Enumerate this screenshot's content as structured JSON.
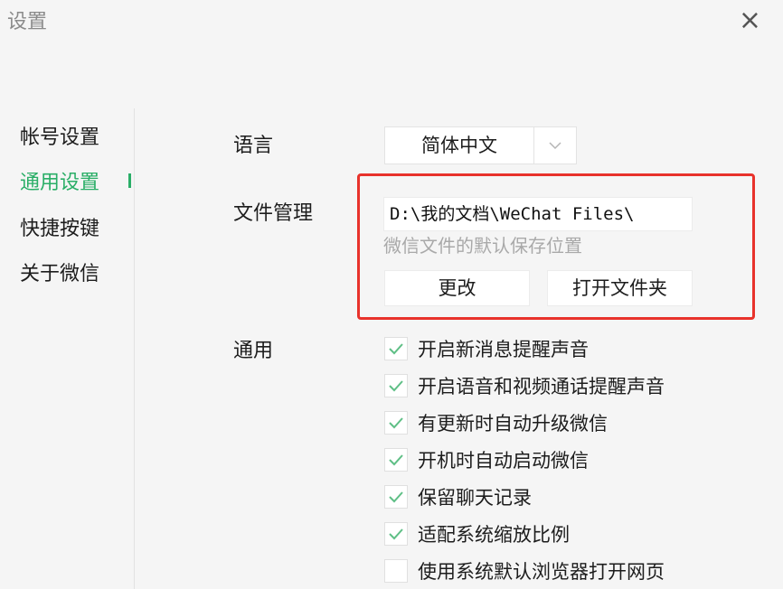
{
  "window": {
    "title": "设置",
    "close_glyph": "×"
  },
  "sidebar": {
    "items": [
      {
        "label": "帐号设置",
        "active": false
      },
      {
        "label": "通用设置",
        "active": true
      },
      {
        "label": "快捷按键",
        "active": false
      },
      {
        "label": "关于微信",
        "active": false
      }
    ]
  },
  "settings": {
    "language": {
      "label": "语言",
      "value": "简体中文",
      "icon": "chevron-down-icon"
    },
    "file_management": {
      "label": "文件管理",
      "path": "D:\\我的文档\\WeChat Files\\",
      "hint": "微信文件的默认保存位置",
      "change_button": "更改",
      "open_folder_button": "打开文件夹",
      "highlight_color": "#e8322b"
    },
    "general": {
      "label": "通用",
      "options": [
        {
          "label": "开启新消息提醒声音",
          "checked": true
        },
        {
          "label": "开启语音和视频通话提醒声音",
          "checked": true
        },
        {
          "label": "有更新时自动升级微信",
          "checked": true
        },
        {
          "label": "开机时自动启动微信",
          "checked": true
        },
        {
          "label": "保留聊天记录",
          "checked": true
        },
        {
          "label": "适配系统缩放比例",
          "checked": true
        },
        {
          "label": "使用系统默认浏览器打开网页",
          "checked": false
        }
      ]
    }
  },
  "colors": {
    "accent": "#2aae67",
    "background": "#f5f5f5",
    "checkmark": "#5fbf86"
  }
}
